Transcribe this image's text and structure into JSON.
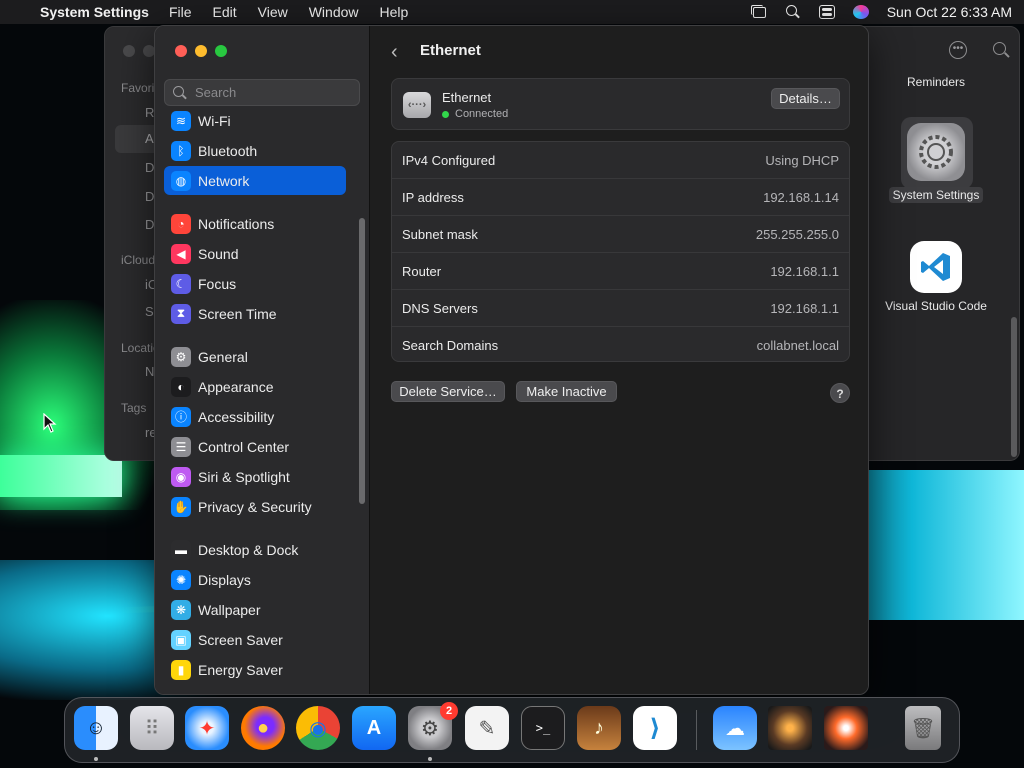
{
  "menubar": {
    "app_name": "System Settings",
    "menus": [
      "File",
      "Edit",
      "View",
      "Window",
      "Help"
    ],
    "clock": "Sun Oct 22  6:33 AM"
  },
  "finder": {
    "sidebar_visible": {
      "favorites": "Favori",
      "icloud": "iCloud",
      "locations": "Locatio",
      "tags": "Tags",
      "row_letters": [
        "R",
        "A",
        "D",
        "D",
        "D",
        "iC",
        "S",
        "N",
        "re"
      ]
    },
    "items": [
      {
        "label": "Reminders"
      },
      {
        "label": "System Settings"
      },
      {
        "label": "Visual Studio Code"
      }
    ]
  },
  "settings": {
    "search_placeholder": "Search",
    "sidebar": [
      {
        "label": "Wi-Fi",
        "icon": "wifi-icon",
        "color": "#0a84ff",
        "glyph": "≋"
      },
      {
        "label": "Bluetooth",
        "icon": "bluetooth-icon",
        "color": "#0a84ff",
        "glyph": "ᛒ"
      },
      {
        "label": "Network",
        "icon": "globe-icon",
        "color": "#0a84ff",
        "glyph": "◍",
        "active": true
      },
      {
        "label": "Notifications",
        "icon": "bell-icon",
        "color": "#ff453a",
        "glyph": "◔"
      },
      {
        "label": "Sound",
        "icon": "speaker-icon",
        "color": "#ff375f",
        "glyph": "◀"
      },
      {
        "label": "Focus",
        "icon": "moon-icon",
        "color": "#5e5ce6",
        "glyph": "☾"
      },
      {
        "label": "Screen Time",
        "icon": "hourglass-icon",
        "color": "#5e5ce6",
        "glyph": "⧗"
      },
      {
        "label": "General",
        "icon": "gear-icon",
        "color": "#8e8e93",
        "glyph": "⚙"
      },
      {
        "label": "Appearance",
        "icon": "appearance-icon",
        "color": "#1c1c1e",
        "glyph": "◐"
      },
      {
        "label": "Accessibility",
        "icon": "accessibility-icon",
        "color": "#0a84ff",
        "glyph": "ⓘ"
      },
      {
        "label": "Control Center",
        "icon": "control-center-icon",
        "color": "#8e8e93",
        "glyph": "☰"
      },
      {
        "label": "Siri & Spotlight",
        "icon": "siri-icon",
        "color": "#bf5af2",
        "glyph": "◉"
      },
      {
        "label": "Privacy & Security",
        "icon": "hand-icon",
        "color": "#0a84ff",
        "glyph": "✋"
      },
      {
        "label": "Desktop & Dock",
        "icon": "dock-icon",
        "color": "#2c2c2e",
        "glyph": "▬"
      },
      {
        "label": "Displays",
        "icon": "sun-icon",
        "color": "#0a84ff",
        "glyph": "✺"
      },
      {
        "label": "Wallpaper",
        "icon": "wallpaper-icon",
        "color": "#32ade6",
        "glyph": "❋"
      },
      {
        "label": "Screen Saver",
        "icon": "screensaver-icon",
        "color": "#64d2ff",
        "glyph": "▣"
      },
      {
        "label": "Energy Saver",
        "icon": "battery-icon",
        "color": "#ffd60a",
        "glyph": "▮"
      }
    ],
    "page_title": "Ethernet",
    "service": {
      "name": "Ethernet",
      "status": "Connected",
      "details_label": "Details…"
    },
    "info": [
      {
        "key": "IPv4 Configured",
        "value": "Using DHCP"
      },
      {
        "key": "IP address",
        "value": "192.168.1.14"
      },
      {
        "key": "Subnet mask",
        "value": "255.255.255.0"
      },
      {
        "key": "Router",
        "value": "192.168.1.1"
      },
      {
        "key": "DNS Servers",
        "value": "192.168.1.1"
      },
      {
        "key": "Search Domains",
        "value": "collabnet.local"
      }
    ],
    "delete_label": "Delete Service…",
    "inactive_label": "Make Inactive",
    "help_label": "?"
  },
  "dock": {
    "items": [
      {
        "name": "finder",
        "glyph": "☺",
        "running": true
      },
      {
        "name": "launchpad",
        "glyph": "⠿"
      },
      {
        "name": "safari",
        "glyph": "✦"
      },
      {
        "name": "firefox",
        "glyph": "●"
      },
      {
        "name": "chrome",
        "glyph": "◉"
      },
      {
        "name": "app-store",
        "glyph": "A"
      },
      {
        "name": "system-settings",
        "glyph": "⚙",
        "badge": "2",
        "running": true
      },
      {
        "name": "textedit",
        "glyph": "✎"
      },
      {
        "name": "terminal",
        "glyph": ">_"
      },
      {
        "name": "garageband",
        "glyph": "♪"
      },
      {
        "name": "vscode",
        "glyph": "⟩"
      },
      {
        "name": "weather",
        "glyph": "☁"
      },
      {
        "name": "photo-1",
        "glyph": ""
      },
      {
        "name": "photo-2",
        "glyph": ""
      },
      {
        "name": "trash",
        "glyph": "🗑"
      }
    ]
  }
}
